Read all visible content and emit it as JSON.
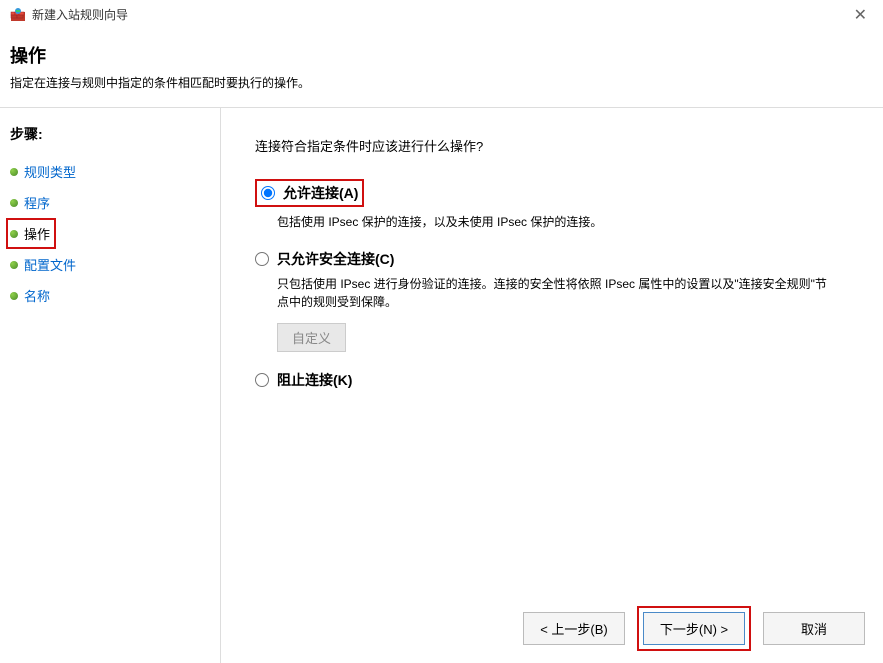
{
  "window": {
    "title": "新建入站规则向导"
  },
  "header": {
    "title": "操作",
    "subtitle": "指定在连接与规则中指定的条件相匹配时要执行的操作。"
  },
  "sidebar": {
    "header": "步骤:",
    "steps": [
      {
        "label": "规则类型"
      },
      {
        "label": "程序"
      },
      {
        "label": "操作"
      },
      {
        "label": "配置文件"
      },
      {
        "label": "名称"
      }
    ]
  },
  "content": {
    "prompt": "连接符合指定条件时应该进行什么操作?",
    "options": [
      {
        "label": "允许连接(A)",
        "desc": "包括使用 IPsec 保护的连接，以及未使用 IPsec 保护的连接。",
        "checked": true
      },
      {
        "label": "只允许安全连接(C)",
        "desc": "只包括使用 IPsec 进行身份验证的连接。连接的安全性将依照 IPsec 属性中的设置以及\"连接安全规则\"节点中的规则受到保障。",
        "checked": false,
        "customize_label": "自定义"
      },
      {
        "label": "阻止连接(K)",
        "desc": "",
        "checked": false
      }
    ]
  },
  "footer": {
    "back": "< 上一步(B)",
    "next": "下一步(N) >",
    "cancel": "取消"
  }
}
